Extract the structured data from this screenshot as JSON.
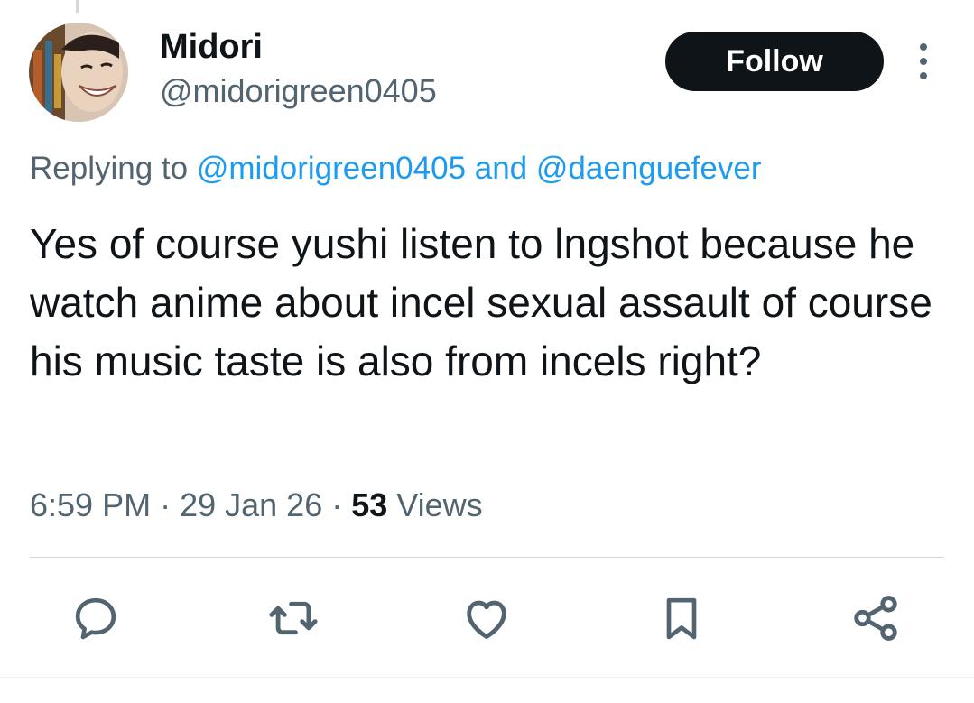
{
  "user": {
    "name": "Midori",
    "handle": "@midorigreen0405"
  },
  "follow_label": "Follow",
  "reply_context": {
    "prefix": "Replying to ",
    "mention1": "@midorigreen0405",
    "conjunction": " and ",
    "mention2": "@daenguefever"
  },
  "tweet": {
    "text": "Yes of course yushi listen to lngshot because he watch anime about incel sexual assault of course his music taste is also from incels right?",
    "time": "6:59 PM",
    "date": "29 Jan 26",
    "separator": " · ",
    "views_count": "53",
    "views_label": " Views"
  },
  "actions": [
    {
      "name": "reply",
      "icon": "speech-bubble-icon"
    },
    {
      "name": "repost",
      "icon": "repost-arrows-icon"
    },
    {
      "name": "like",
      "icon": "heart-icon"
    },
    {
      "name": "bookmark",
      "icon": "bookmark-icon"
    },
    {
      "name": "share",
      "icon": "share-nodes-icon"
    }
  ],
  "colors": {
    "text": "#0f1419",
    "secondary": "#536471",
    "link": "#1d9bf0",
    "button_bg": "#0f1419",
    "button_text": "#ffffff",
    "divider": "#cfd9de"
  }
}
